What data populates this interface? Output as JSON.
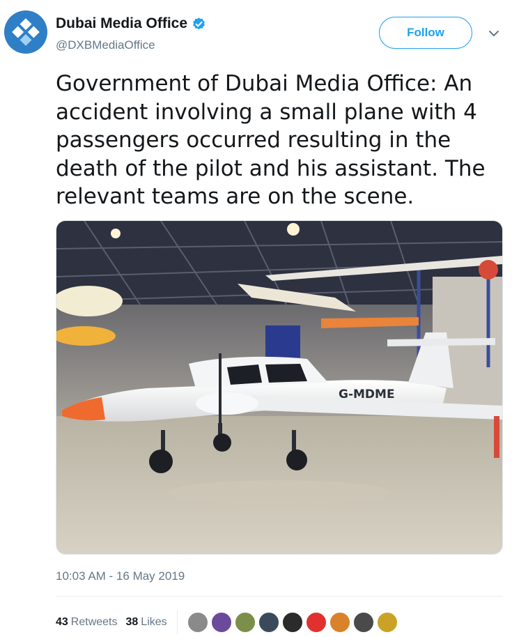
{
  "header": {
    "display_name": "Dubai Media Office",
    "handle": "@DXBMediaOffice",
    "follow_label": "Follow",
    "avatar_icon": "dubai-media-office-logo",
    "verified_icon": "verified-badge-icon",
    "menu_icon": "chevron-down-icon"
  },
  "tweet": {
    "lines": [
      "Government of Dubai Media Office: An",
      "accident involving a small plane with 4",
      "passengers occurred resulting in the",
      "death of the pilot and his assistant. The",
      "relevant teams are on the scene."
    ],
    "photo_registration": "G-MDME"
  },
  "meta": {
    "timestamp": "10:03 AM - 16 May 2019"
  },
  "stats": {
    "retweets_count": "43",
    "retweets_label": "Retweets",
    "likes_count": "38",
    "likes_label": "Likes"
  },
  "likers": [
    {
      "name": "liker-avatar-1",
      "color": "#8a8a8a"
    },
    {
      "name": "liker-avatar-2",
      "color": "#6b4a9b"
    },
    {
      "name": "liker-avatar-3",
      "color": "#7b8f4a"
    },
    {
      "name": "liker-avatar-4",
      "color": "#3b4a5b"
    },
    {
      "name": "liker-avatar-5",
      "color": "#2b2b2b"
    },
    {
      "name": "liker-avatar-6",
      "color": "#e0312f"
    },
    {
      "name": "liker-avatar-7",
      "color": "#d9822b"
    },
    {
      "name": "liker-avatar-8",
      "color": "#4a4a4a"
    },
    {
      "name": "liker-avatar-9",
      "color": "#c9a227"
    }
  ],
  "colors": {
    "accent": "#1da1f2",
    "muted": "#657786",
    "avatar_bg": "#2f7fc7"
  }
}
